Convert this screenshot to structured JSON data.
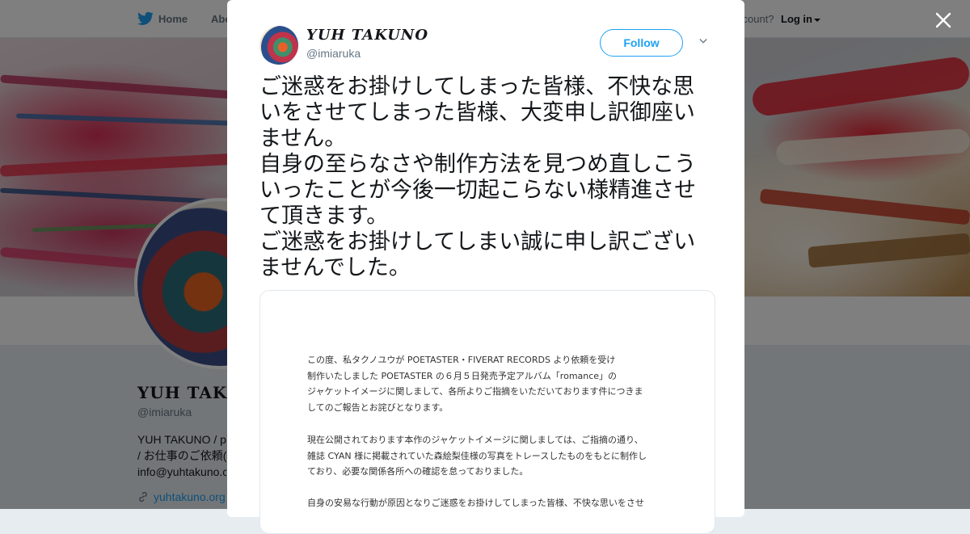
{
  "nav": {
    "home_label": "Home",
    "about_label": "Abo",
    "account_text": "ccount?",
    "login_label": "Log in"
  },
  "profile": {
    "display_name": "YUH TAKUNO",
    "handle": "@imiaruka",
    "bio_line1": "YUH TAKUNO / p",
    "bio_line2": "/ お仕事のご依頼(",
    "bio_line3": "info@yuhtakuno.co",
    "website": "yuhtakuno.org"
  },
  "tweet": {
    "author_name": "YUH TAKUNO",
    "author_handle": "@imiaruka",
    "follow_label": "Follow",
    "text": "ご迷惑をお掛けしてしまった皆様、不快な思いをさせてしまった皆様、大変申し訳御座いません。\n自身の至らなさや制作方法を見つめ直しこういったことが今後一切起こらない様精進させて頂きます。\nご迷惑をお掛けしてしまい誠に申し訳ございませんでした。",
    "document": {
      "para1": "この度、私タクノユウが POETASTER・FIVERAT RECORDS より依頼を受け\n制作いたしました POETASTER の６月５日発売予定アルバム「romance」の\nジャケットイメージに関しまして、各所よりご指摘をいただいております件につきま\nしてのご報告とお詫びとなります。",
      "para2": "現在公開されております本作のジャケットイメージに関しましては、ご指摘の通り、\n雑誌 CYAN 様に掲載されていた森絵梨佳様の写真をトレースしたものをもとに制作し\nており、必要な関係各所への確認を怠っておりました。",
      "para3": "自身の安易な行動が原因となりご迷惑をお掛けしてしまった皆様、不快な思いをさせ"
    }
  },
  "colors": {
    "accent": "#1da1f2",
    "overlay": "rgba(0,0,0,0.5)"
  },
  "icons": {
    "bird": "twitter-bird-icon",
    "close": "close-icon",
    "chevron": "chevron-down-icon",
    "link": "link-icon"
  }
}
